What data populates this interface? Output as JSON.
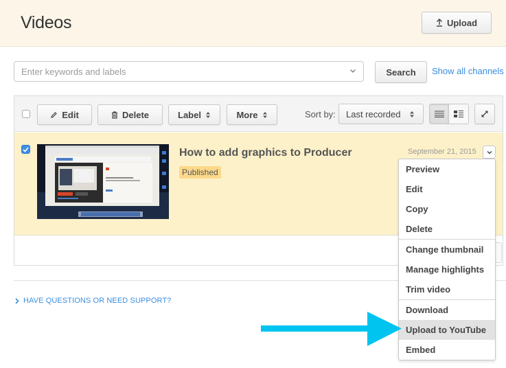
{
  "header": {
    "title": "Videos",
    "upload_label": "Upload",
    "upload_icon": "upload-arrow-icon"
  },
  "search": {
    "placeholder": "Enter keywords and labels",
    "value": "",
    "button_label": "Search",
    "show_all_label": "Show all channels"
  },
  "toolbar": {
    "select_all_checked": false,
    "edit_label": "Edit",
    "delete_label": "Delete",
    "label_label": "Label",
    "more_label": "More",
    "sort_label": "Sort by:",
    "sort_value": "Last recorded",
    "view_modes": [
      "list",
      "detail"
    ],
    "active_view": "list"
  },
  "videos": [
    {
      "title": "How to add graphics to Producer",
      "status": "Published",
      "date": "September 21, 2015",
      "checked": true
    }
  ],
  "row_menu": {
    "groups": [
      [
        "Preview",
        "Edit",
        "Copy",
        "Delete"
      ],
      [
        "Change thumbnail",
        "Manage highlights",
        "Trim video"
      ],
      [
        "Download",
        "Upload to YouTube",
        "Embed"
      ]
    ],
    "highlighted": "Upload to YouTube"
  },
  "footer": {
    "support_label": "Have questions or need support?"
  },
  "colors": {
    "header_bg": "#fdf6e8",
    "selected_row_bg": "#fdf1c9",
    "badge_bg": "#fcd98a",
    "link": "#3a8de0",
    "annotation_arrow": "#00c4f0",
    "checkbox_checked": "#3d8ee6"
  }
}
